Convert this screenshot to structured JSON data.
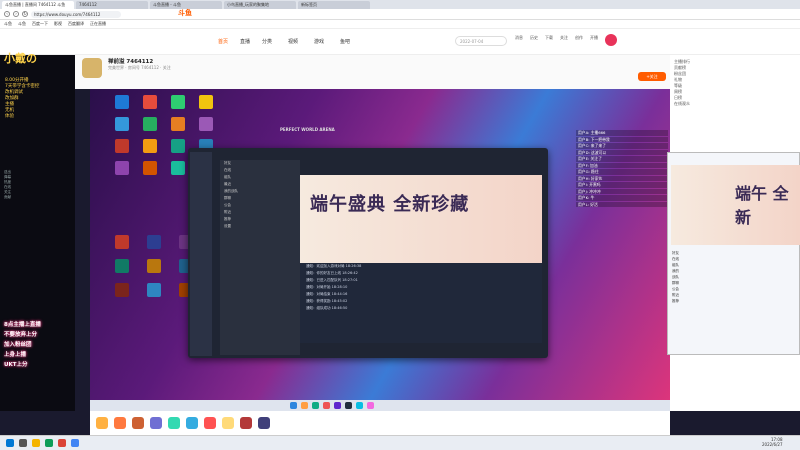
{
  "browser": {
    "tabs": [
      {
        "label": "斗鱼直播 | 直播间 7464112 斗鱼"
      },
      {
        "label": "7464112"
      },
      {
        "label": "斗鱼直播 - 斗鱼"
      },
      {
        "label": "小鸟直播_玩家的聚集地"
      },
      {
        "label": "新标签页"
      }
    ],
    "url": "https://www.douyu.com/7464112",
    "bookmarks": [
      "斗鱼",
      "斗鱼",
      "百度一下",
      "影视",
      "百度翻译",
      "正在直播"
    ]
  },
  "site": {
    "logo": "斗鱼",
    "nav": [
      "首页",
      "直播",
      "分类",
      "视频",
      "游戏",
      "鱼吧"
    ],
    "search_placeholder": "2022-07-04",
    "header_icons": [
      "消息",
      "历史",
      "下载",
      "关注",
      "创作",
      "开播"
    ]
  },
  "room": {
    "streamer_title": "禅前溢 7464112",
    "meta": "完美世界 · 房间号 7464112 · 关注",
    "follow_label": "+关注"
  },
  "overlay": {
    "title": "小戴の",
    "lines": [
      "8.00分开播",
      "7天带学含卡密控",
      "改机调试",
      "改加群",
      "主播",
      "无机",
      "体验"
    ],
    "stats": [
      "送出",
      "弹幕",
      "热度",
      "在线",
      "关注",
      "贡献"
    ],
    "gifts": [
      "8点主播上直播",
      "不要放弃上分",
      "加入粉丝团",
      "上身上播",
      "UKT上分"
    ]
  },
  "game": {
    "window_title": "PERFECT WORLD ARENA",
    "banner_text": "端午盛典 全新珍藏",
    "list": [
      "好友",
      "在线",
      "组队",
      "最近",
      "我的战队",
      "群聊",
      "公会",
      "附近",
      "推荐",
      "设置"
    ],
    "messages": [
      "通知：欢迎加入游戏对局 18:26:38",
      "通知：你的好友已上线 18:26:42",
      "通知：已进入匹配队列 18:27:01",
      "通知：对局开始 18:28:10",
      "通知：对局结束 18:44:16",
      "通知：获得奖励 18:45:02",
      "通知：组队成功 18:46:50"
    ]
  },
  "overlay_chat": [
    "用户A: 主播666",
    "用户B: 下一把带我",
    "用户C: 来了来了",
    "用户D: 这波可以",
    "用户E: 关注了",
    "用户F: 加油",
    "用户G: 稳住",
    "用户H: 好家伙",
    "用户I: 开黑吗",
    "用户J: 冲冲冲",
    "用户K: 牛",
    "用户L: 好活"
  ],
  "right_panel": {
    "items": [
      "主播排行",
      "贡献榜",
      "粉丝团",
      "礼物",
      "等级",
      "周榜",
      "日榜",
      "在线观众"
    ]
  },
  "float_win": {
    "banner_text": "端午 全新",
    "items": [
      "好友",
      "在线",
      "组队",
      "我的",
      "战队",
      "群聊",
      "公会",
      "附近",
      "推荐"
    ]
  },
  "clock": {
    "time": "17:08",
    "date": "2022/6/27"
  },
  "colors": {
    "accent": "#ff5c00",
    "overlay_yellow": "#ffd34a",
    "glow": "#e0357a"
  }
}
